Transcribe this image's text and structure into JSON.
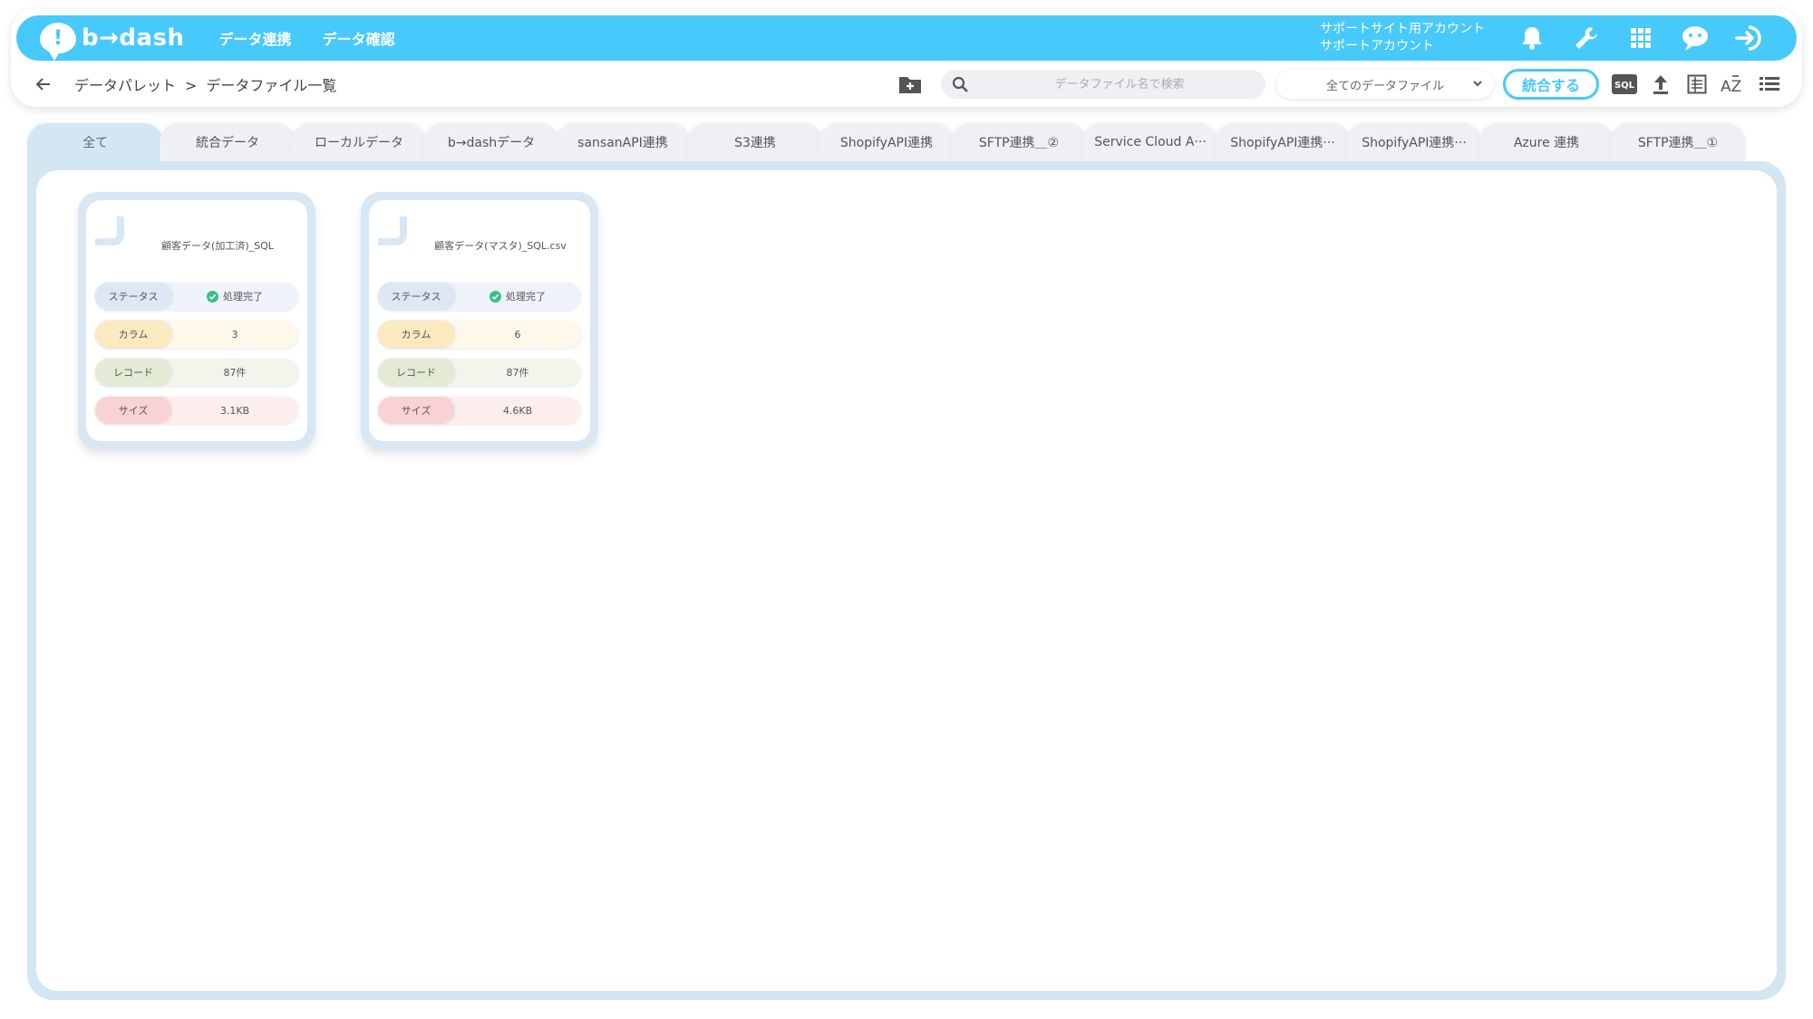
{
  "header": {
    "logo_mark": "!",
    "logo_text": "b→dash",
    "nav": [
      "データ連携",
      "データ確認"
    ],
    "account_line1": "サポートサイト用アカウント",
    "account_line2": "サポートアカウント",
    "icons": [
      "bell-icon",
      "wrench-icon",
      "grid-apps-icon",
      "chat-character-icon",
      "logout-icon"
    ]
  },
  "subbar": {
    "breadcrumb_parent": "データパレット",
    "breadcrumb_sep": ">",
    "breadcrumb_current": "データファイル一覧",
    "search_placeholder": "データファイル名で検索",
    "filter_selected": "全てのデータファイル",
    "merge_label": "統合する",
    "sql_label": "SQL",
    "sort_label": "AZ"
  },
  "tabs": [
    {
      "label": "全て",
      "active": true
    },
    {
      "label": "統合データ",
      "active": false
    },
    {
      "label": "ローカルデータ",
      "active": false
    },
    {
      "label": "b→dashデータ",
      "active": false
    },
    {
      "label": "sansanAPI連携",
      "active": false
    },
    {
      "label": "S3連携",
      "active": false
    },
    {
      "label": "ShopifyAPI連携",
      "active": false
    },
    {
      "label": "SFTP連携＿②",
      "active": false
    },
    {
      "label": "Service Cloud A···",
      "active": false
    },
    {
      "label": "ShopifyAPI連携···",
      "active": false
    },
    {
      "label": "ShopifyAPI連携···",
      "active": false
    },
    {
      "label": "Azure 連携",
      "active": false
    },
    {
      "label": "SFTP連携＿①",
      "active": false
    }
  ],
  "files": [
    {
      "name": "顧客データ(加工済)_SQL",
      "status_label": "ステータス",
      "status": "処理完了",
      "column_label": "カラム",
      "columns": "3",
      "record_label": "レコード",
      "records": "87件",
      "size_label": "サイズ",
      "size": "3.1KB"
    },
    {
      "name": "顧客データ(マスタ)_SQL.csv",
      "status_label": "ステータス",
      "status": "処理完了",
      "column_label": "カラム",
      "columns": "6",
      "record_label": "レコード",
      "records": "87件",
      "size_label": "サイズ",
      "size": "4.6KB"
    }
  ],
  "colors": {
    "brand": "#48c9fb",
    "panel": "#d5e6f3",
    "status_ok": "#3cc08a"
  }
}
